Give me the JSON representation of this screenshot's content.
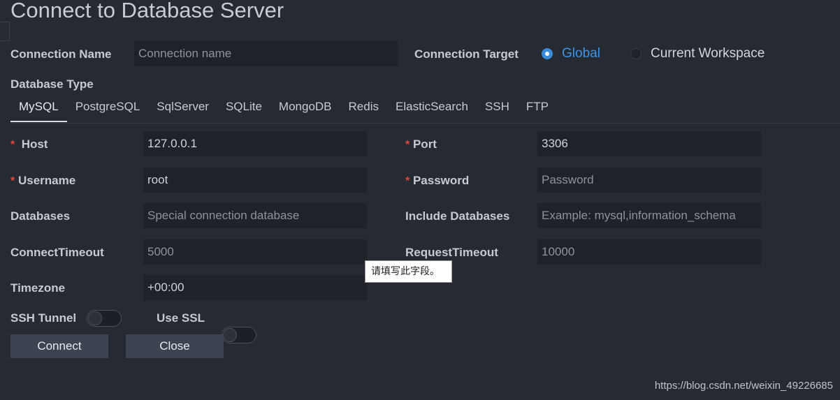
{
  "page": {
    "title": "Connect to Database Server"
  },
  "connection": {
    "name_label": "Connection Name",
    "name_placeholder": "Connection name",
    "name_value": "",
    "target_label": "Connection Target",
    "target_options": [
      {
        "label": "Global",
        "selected": true
      },
      {
        "label": "Current Workspace",
        "selected": false
      }
    ]
  },
  "database_type": {
    "label": "Database Type",
    "tabs": [
      {
        "label": "MySQL",
        "active": true
      },
      {
        "label": "PostgreSQL",
        "active": false
      },
      {
        "label": "SqlServer",
        "active": false
      },
      {
        "label": "SQLite",
        "active": false
      },
      {
        "label": "MongoDB",
        "active": false
      },
      {
        "label": "Redis",
        "active": false
      },
      {
        "label": "ElasticSearch",
        "active": false
      },
      {
        "label": "SSH",
        "active": false
      },
      {
        "label": "FTP",
        "active": false
      }
    ]
  },
  "form": {
    "required_mark": "*",
    "host": {
      "label": "Host",
      "value": "127.0.0.1",
      "placeholder": ""
    },
    "port": {
      "label": "Port",
      "value": "3306",
      "placeholder": ""
    },
    "username": {
      "label": "Username",
      "value": "root",
      "placeholder": ""
    },
    "password": {
      "label": "Password",
      "value": "",
      "placeholder": "Password"
    },
    "databases": {
      "label": "Databases",
      "value": "",
      "placeholder": "Special connection database"
    },
    "include_databases": {
      "label": "Include Databases",
      "value": "",
      "placeholder": "Example: mysql,information_schema"
    },
    "connect_timeout": {
      "label": "ConnectTimeout",
      "value": "",
      "placeholder": "5000"
    },
    "request_timeout": {
      "label": "RequestTimeout",
      "value": "",
      "placeholder": "10000"
    },
    "timezone": {
      "label": "Timezone",
      "value": "+00:00",
      "placeholder": ""
    },
    "ssh_tunnel": {
      "label": "SSH Tunnel",
      "enabled": false
    },
    "use_ssl": {
      "label": "Use SSL",
      "enabled": false
    }
  },
  "buttons": {
    "connect": "Connect",
    "close": "Close"
  },
  "tooltip": {
    "text": "请填写此字段。"
  },
  "watermark": {
    "text": "https://blog.csdn.net/weixin_49226685"
  },
  "colors": {
    "background": "#262a33",
    "input_background": "#1f2228",
    "accent": "#3a8bd8",
    "required": "#e0473f",
    "button": "#3d4451"
  }
}
